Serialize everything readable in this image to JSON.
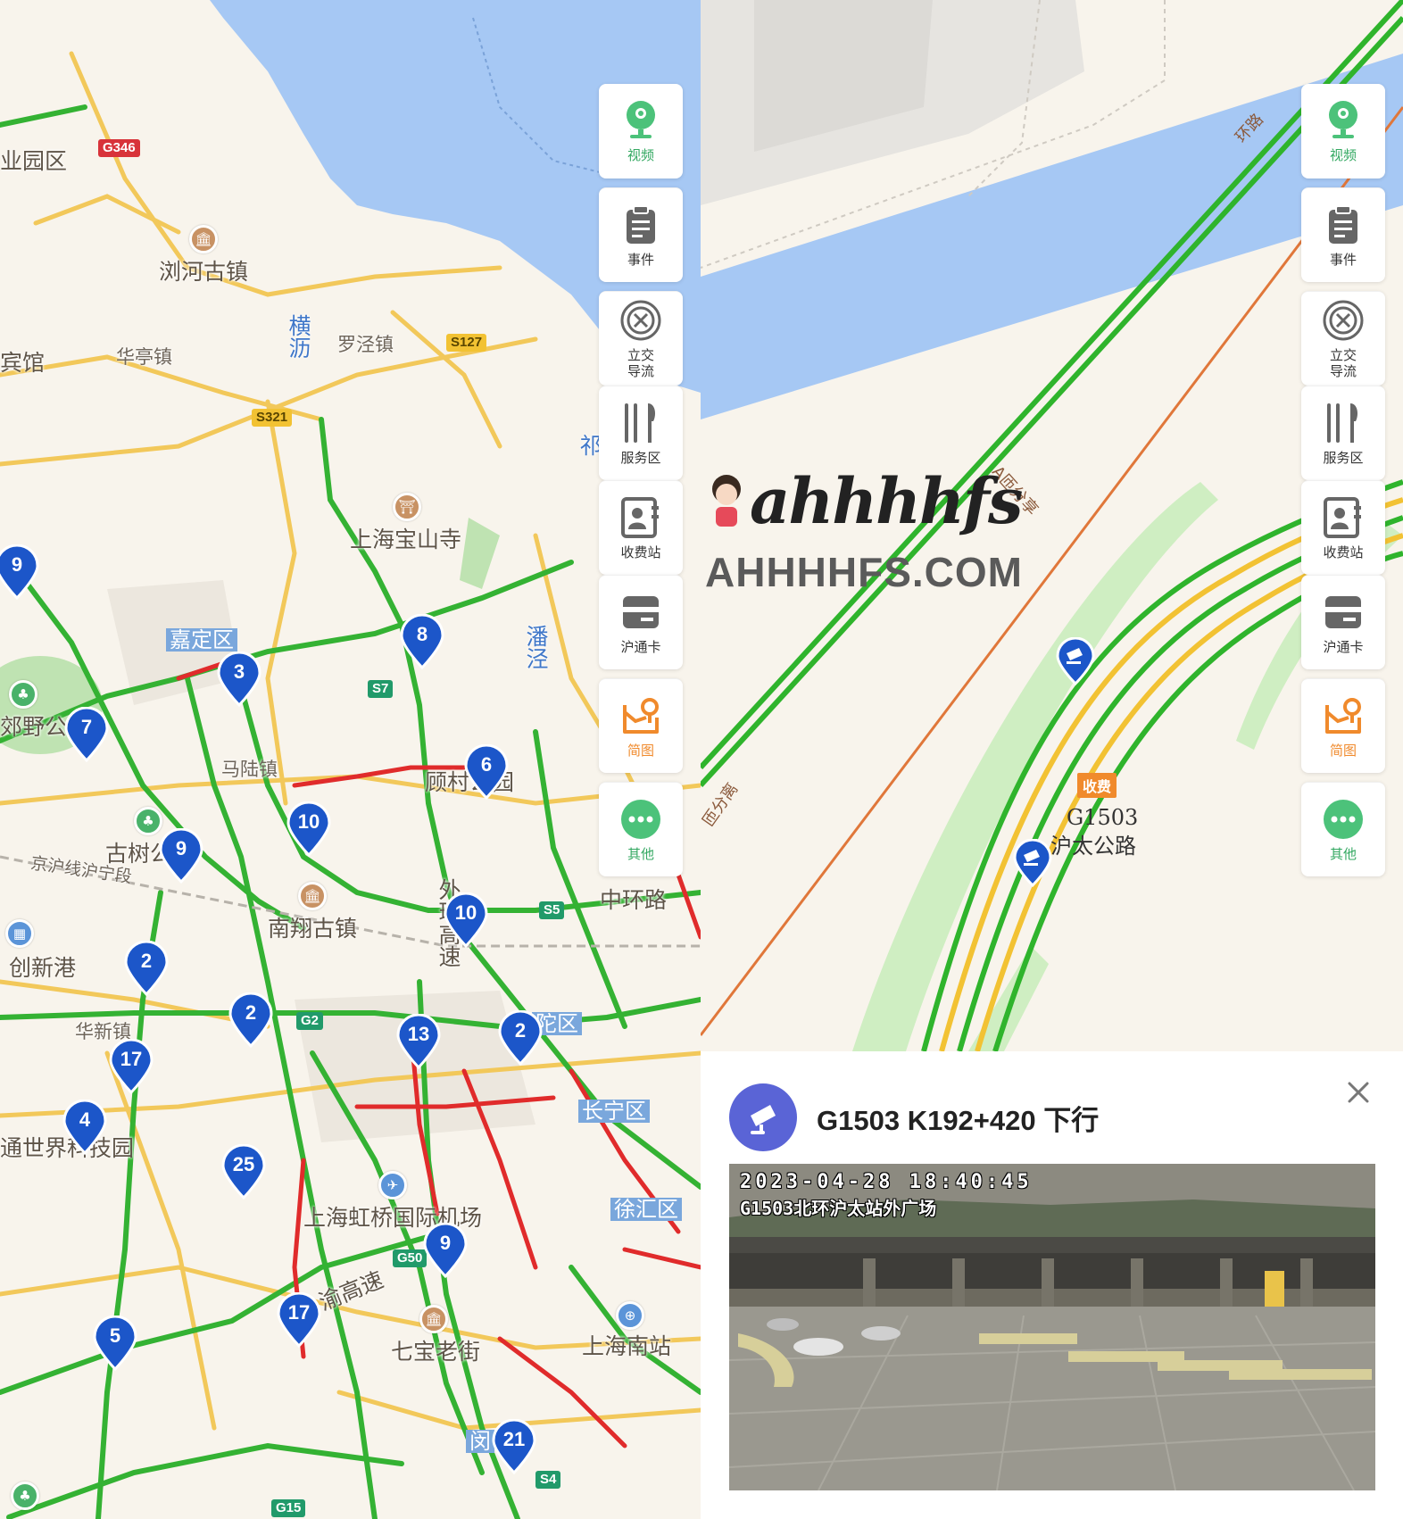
{
  "left_map": {
    "labels": {
      "l0": "业园区",
      "l1": "浏河古镇",
      "l2": "横沥",
      "l3": "罗泾镇",
      "l4": "华亭镇",
      "l5": "宾馆",
      "l6": "上海宝山寺",
      "l7": "潘泾",
      "l8": "马陆镇",
      "l9": "顾村公园",
      "l10": "郊野公",
      "l11": "古树公",
      "l12": "京沪线沪宁段",
      "l13": "南翔古镇",
      "l14": "外环高速",
      "l15": "中环路",
      "l16": "创新港",
      "l17": "华新镇",
      "l18": "通世界科技园",
      "l19": "上海虹桥国际机场",
      "l20": "渝高速",
      "l21": "七宝老街",
      "l22": "上海南站",
      "l23": "闵",
      "l24": "祁"
    },
    "districts": {
      "d0": "嘉定区",
      "d1": "长宁区",
      "d2": "徐汇区",
      "d3": "陀区"
    },
    "shields": {
      "s0": "G346",
      "s1": "S127",
      "s2": "S321",
      "s3": "S7",
      "s4": "S5",
      "s5": "G2",
      "s6": "G50",
      "s7": "S4",
      "s8": "G15"
    },
    "clusters": {
      "c0": "9",
      "c1": "3",
      "c2": "8",
      "c3": "7",
      "c4": "6",
      "c5": "10",
      "c6": "9",
      "c7": "10",
      "c8": "2",
      "c9": "2",
      "c10": "13",
      "c11": "2",
      "c12": "17",
      "c13": "4",
      "c14": "25",
      "c15": "9",
      "c16": "17",
      "c17": "5",
      "c18": "21"
    }
  },
  "toolbar": {
    "items": [
      {
        "label": "视频",
        "icon": "video-camera-icon"
      },
      {
        "label": "事件",
        "icon": "clipboard-icon"
      },
      {
        "label": "立交导流",
        "icon": "interchange-icon"
      },
      {
        "label": "服务区",
        "icon": "fork-knife-icon"
      },
      {
        "label": "收费站",
        "icon": "toll-station-icon"
      },
      {
        "label": "沪通卡",
        "icon": "card-icon"
      },
      {
        "label": "简图",
        "icon": "sketch-map-icon"
      },
      {
        "label": "其他",
        "icon": "more-icon"
      }
    ],
    "accent_green": "#33a861",
    "accent_orange": "#f08a2c"
  },
  "watermark": {
    "script": "ahhhhfs",
    "url": "AHHHHFS.COM"
  },
  "right_map": {
    "road_label_1": "A匝分享",
    "road_label_2": "环路",
    "road_label_3": "匝分离",
    "toll_badge": "收费",
    "toll_name_1": "G1503",
    "toll_name_2": "沪太公路"
  },
  "detail": {
    "title": "G1503 K192+420 下行",
    "camera_timestamp": "2023-04-28 18:40:45",
    "camera_location": "G1503北环沪太站外广场",
    "badge_color": "#5a64d6"
  }
}
